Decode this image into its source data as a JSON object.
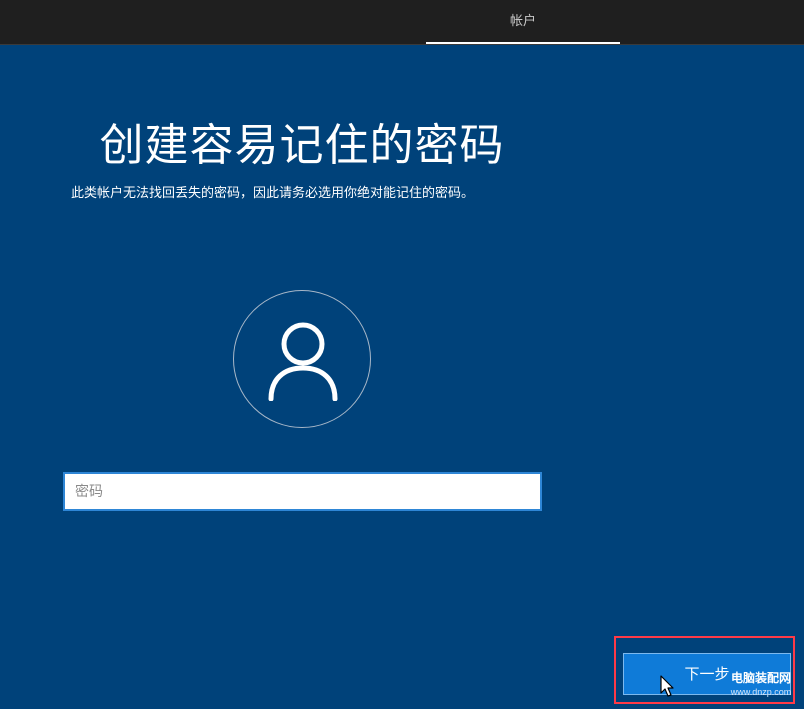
{
  "top_bar": {
    "tab_label": "帐户"
  },
  "main": {
    "title": "创建容易记住的密码",
    "subtitle": "此类帐户无法找回丢失的密码，因此请务必选用你绝对能记住的密码。",
    "password_placeholder": "密码",
    "avatar_icon": "user-icon"
  },
  "footer": {
    "next_label": "下一步"
  },
  "watermark": {
    "line1": "电脑装配网",
    "line2": "www.dnzp.com"
  },
  "colors": {
    "background": "#00427a",
    "topbar": "#1f1f1f",
    "button": "#0f7bd8",
    "highlight": "#ff3a47"
  }
}
